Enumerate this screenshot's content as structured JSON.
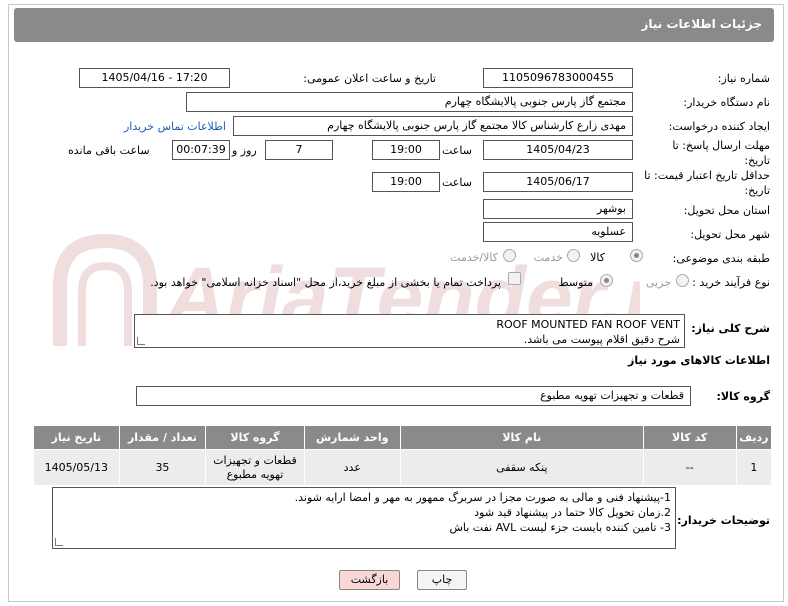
{
  "header": {
    "title": "جزئیات اطلاعات نیاز"
  },
  "watermark": {
    "text": "AriaTender.neT"
  },
  "fields": {
    "need_number_label": "شماره نیاز:",
    "need_number": "1105096783000455",
    "announce_label": "تاریخ و ساعت اعلان عمومی:",
    "announce_value": "1405/04/16 - 17:20",
    "buyer_org_label": "نام دستگاه خریدار:",
    "buyer_org": "مجتمع گاز پارس جنوبی  پالایشگاه چهارم",
    "requester_label": "ایجاد کننده درخواست:",
    "requester": "مهدی زارع کارشناس کالا مجتمع گاز پارس جنوبی  پالایشگاه چهارم",
    "buyer_contact_link": "اطلاعات تماس خریدار",
    "reply_deadline_label": "مهلت ارسال پاسخ: تا تاریخ:",
    "reply_date": "1405/04/23",
    "time_label": "ساعت",
    "reply_time": "19:00",
    "reply_days": "7",
    "days_and_label": "روز و",
    "reply_remaining": "00:07:39",
    "remaining_label": "ساعت باقی مانده",
    "price_validity_label": "حداقل تاریخ اعتبار قیمت: تا تاریخ:",
    "price_date": "1405/06/17",
    "price_time": "19:00",
    "province_label": "استان محل تحویل:",
    "province": "بوشهر",
    "city_label": "شهر محل تحویل:",
    "city": "عسلویه",
    "category_label": "طبقه بندی موضوعی:",
    "category_options": [
      "کالا",
      "خدمت",
      "کالا/خدمت"
    ],
    "process_label": "نوع فرآیند خرید :",
    "process_options": [
      "جزیی",
      "متوسط"
    ],
    "payment_note": "پرداخت تمام یا بخشی از مبلغ خرید،از محل \"اسناد خزانه اسلامی\" خواهد بود."
  },
  "description": {
    "label": "شرح کلی نیاز:",
    "line1": "ROOF MOUNTED FAN ROOF VENT",
    "line2": "شرح دقیق اقلام پیوست می باشد."
  },
  "goods_info_title": "اطلاعات کالاهای مورد نیاز",
  "goods_group": {
    "label": "گروه کالا:",
    "value": "قطعات و تجهیزات تهویه مطبوع"
  },
  "table": {
    "headers": [
      "ردیف",
      "کد کالا",
      "نام کالا",
      "واحد شمارش",
      "گروه کالا",
      "تعداد / مقدار",
      "تاریخ نیاز"
    ],
    "rows": [
      [
        "1",
        "--",
        "پنکه سقفی",
        "عدد",
        "قطعات و تجهیزات تهویه مطبوع",
        "35",
        "1405/05/13"
      ]
    ]
  },
  "buyer_notes": {
    "label": "توضیحات خریدار:",
    "line1": "1-پیشنهاد فنی و مالی به صورت مجزا در سربرگ ممهور به مهر و امضا ارایه شوند.",
    "line2": "2.زمان تحویل کالا حتما در پیشنهاد قید شود",
    "line3": "3- تامین کننده بایست جزء  لیست AVL نفت باش"
  },
  "buttons": {
    "print": "چاپ",
    "back": "بازگشت"
  }
}
